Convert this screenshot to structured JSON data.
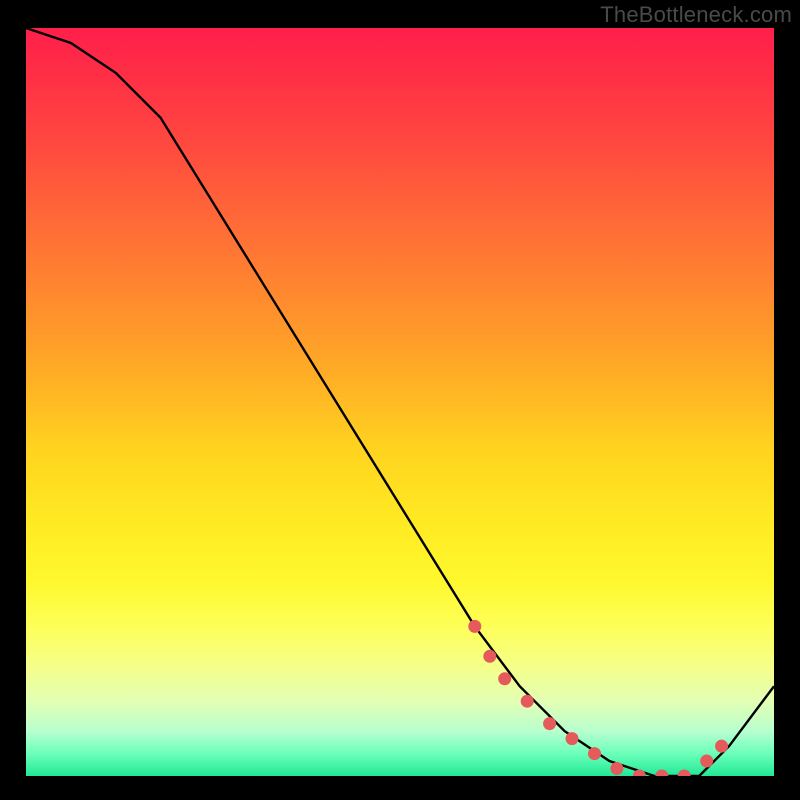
{
  "watermark": "TheBottleneck.com",
  "chart_data": {
    "type": "line",
    "title": "",
    "xlabel": "",
    "ylabel": "",
    "xlim": [
      0,
      100
    ],
    "ylim": [
      0,
      100
    ],
    "series": [
      {
        "name": "curve",
        "x": [
          0,
          6,
          12,
          18,
          60,
          66,
          72,
          78,
          84,
          90,
          94,
          100
        ],
        "y": [
          100,
          98,
          94,
          88,
          20,
          12,
          6,
          2,
          0,
          0,
          4,
          12
        ]
      }
    ],
    "markers": {
      "name": "highlight-dots",
      "color": "#e55a5a",
      "x": [
        60,
        62,
        64,
        67,
        70,
        73,
        76,
        79,
        82,
        85,
        88,
        91,
        93
      ],
      "y": [
        20,
        16,
        13,
        10,
        7,
        5,
        3,
        1,
        0,
        0,
        0,
        2,
        4
      ]
    },
    "gradient_stops": [
      {
        "pos": 0,
        "color": "#ff1f4b"
      },
      {
        "pos": 50,
        "color": "#ffc221"
      },
      {
        "pos": 80,
        "color": "#fdff58"
      },
      {
        "pos": 100,
        "color": "#22e896"
      }
    ]
  }
}
